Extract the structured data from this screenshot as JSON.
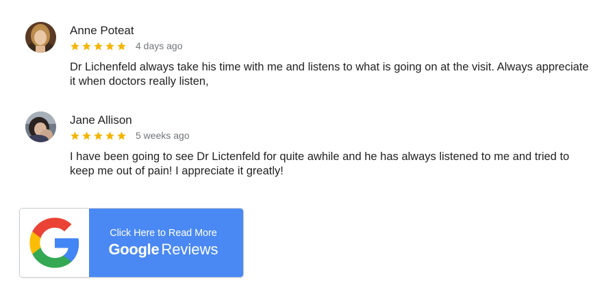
{
  "reviews": [
    {
      "author": "Anne Poteat",
      "rating": 5,
      "time": "4 days ago",
      "text": "Dr Lichenfeld always take his time with me and listens to what is going on at the visit. Always appreciate it when doctors really listen,"
    },
    {
      "author": "Jane Allison",
      "rating": 5,
      "time": "5 weeks ago",
      "text": "I have been going to see Dr Lictenfeld for quite awhile and he has always listened to me and tried to keep me out of pain! I appreciate it greatly!"
    }
  ],
  "cta": {
    "line1": "Click Here to Read More",
    "brand": "Google",
    "word": "Reviews",
    "icon": "google-g-icon"
  },
  "colors": {
    "star": "#f5b400",
    "button_blue": "#4a89f3",
    "google_blue": "#4285f4",
    "google_red": "#ea4335",
    "google_yellow": "#fbbc05",
    "google_green": "#34a853"
  }
}
